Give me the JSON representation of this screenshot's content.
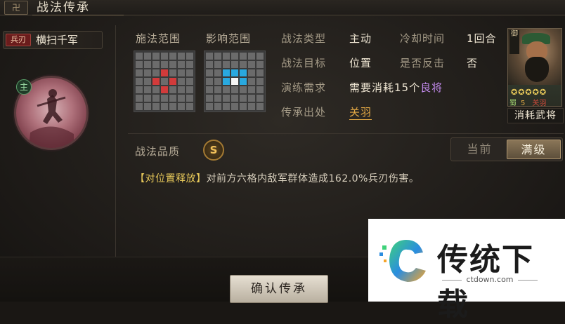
{
  "title": "战法传承",
  "title_icon": "卍",
  "skill": {
    "type_badge": "兵刃",
    "name": "横扫千军",
    "main_badge": "主"
  },
  "ranges": {
    "cast_label": "施法范围",
    "effect_label": "影响范围"
  },
  "info": {
    "type_label": "战法类型",
    "type_value": "主动",
    "cooldown_label": "冷却时间",
    "cooldown_value": "1回合",
    "target_label": "战法目标",
    "target_value": "位置",
    "counter_label": "是否反击",
    "counter_value": "否",
    "drill_label": "演练需求",
    "drill_prefix": "需要消耗",
    "drill_count": "15个",
    "drill_unit": "良将",
    "source_label": "传承出处",
    "source_value": "关羽"
  },
  "general_card": {
    "side_tag": "御",
    "stars": "✪✪✪✪✪",
    "faction": "蜀",
    "cost": "5",
    "name": "关羽",
    "consume_label": "消耗武将"
  },
  "quality": {
    "label": "战法品质",
    "grade": "S"
  },
  "level_toggle": {
    "current": "当前",
    "max": "满级",
    "selected": "max"
  },
  "description": {
    "tag": "【对位置释放】",
    "text": "对前方六格内敌军群体造成162.0%兵刃伤害。"
  },
  "confirm_button": "确认传承",
  "watermark": {
    "brand": "传统下载",
    "url": "ctdown.com"
  },
  "colors": {
    "gold": "#e2a845",
    "purple": "#c58cf0",
    "grid_red": "#d23b3b",
    "grid_blue": "#29a9e0"
  }
}
